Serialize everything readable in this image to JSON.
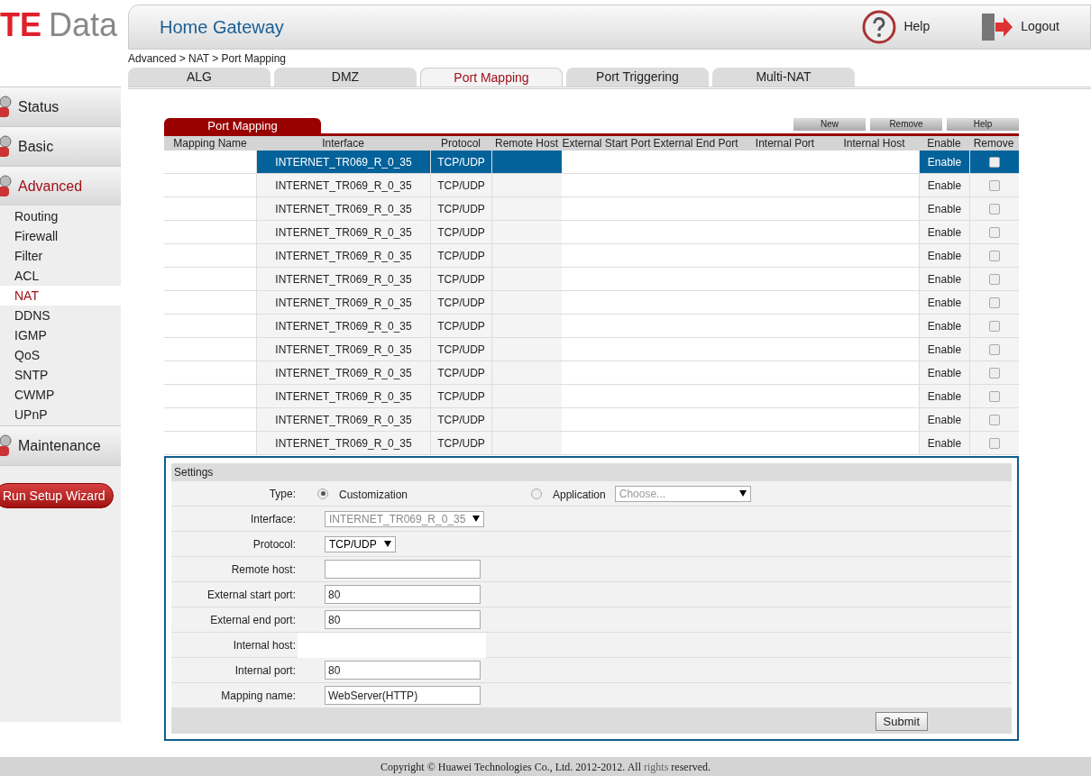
{
  "logo": {
    "accent": "TE",
    "name": "Data"
  },
  "header": {
    "title": "Home Gateway",
    "help": "Help",
    "logout": "Logout"
  },
  "breadcrumb": "Advanced > NAT > Port Mapping",
  "sidebar": {
    "sections": [
      {
        "label": "Status",
        "selected": false
      },
      {
        "label": "Basic",
        "selected": false
      },
      {
        "label": "Advanced",
        "selected": true,
        "children": [
          {
            "label": "Routing",
            "selected": false
          },
          {
            "label": "Firewall",
            "selected": false
          },
          {
            "label": "Filter",
            "selected": false
          },
          {
            "label": "ACL",
            "selected": false
          },
          {
            "label": "NAT",
            "selected": true
          },
          {
            "label": "DDNS",
            "selected": false
          },
          {
            "label": "IGMP",
            "selected": false
          },
          {
            "label": "QoS",
            "selected": false
          },
          {
            "label": "SNTP",
            "selected": false
          },
          {
            "label": "CWMP",
            "selected": false
          },
          {
            "label": "UPnP",
            "selected": false
          }
        ]
      },
      {
        "label": "Maintenance",
        "selected": false
      }
    ],
    "wizard_button": "Run Setup Wizard"
  },
  "tabs": [
    {
      "label": "ALG",
      "selected": false
    },
    {
      "label": "DMZ",
      "selected": false
    },
    {
      "label": "Port Mapping",
      "selected": true
    },
    {
      "label": "Port Triggering",
      "selected": false
    },
    {
      "label": "Multi-NAT",
      "selected": false
    }
  ],
  "table": {
    "title": "Port Mapping",
    "buttons": [
      "New",
      "Remove",
      "Help"
    ],
    "columns": [
      "Mapping Name",
      "Interface",
      "Protocol",
      "Remote Host",
      "External Start Port",
      "External End Port",
      "Internal Port",
      "Internal Host",
      "Enable",
      "Remove"
    ],
    "rows": [
      {
        "interface": "INTERNET_TR069_R_0_35",
        "protocol": "TCP/UDP",
        "enable": "Enable",
        "checked": false,
        "selected": true
      },
      {
        "interface": "INTERNET_TR069_R_0_35",
        "protocol": "TCP/UDP",
        "enable": "Enable",
        "checked": false,
        "selected": false
      },
      {
        "interface": "INTERNET_TR069_R_0_35",
        "protocol": "TCP/UDP",
        "enable": "Enable",
        "checked": false,
        "selected": false
      },
      {
        "interface": "INTERNET_TR069_R_0_35",
        "protocol": "TCP/UDP",
        "enable": "Enable",
        "checked": false,
        "selected": false
      },
      {
        "interface": "INTERNET_TR069_R_0_35",
        "protocol": "TCP/UDP",
        "enable": "Enable",
        "checked": false,
        "selected": false
      },
      {
        "interface": "INTERNET_TR069_R_0_35",
        "protocol": "TCP/UDP",
        "enable": "Enable",
        "checked": false,
        "selected": false
      },
      {
        "interface": "INTERNET_TR069_R_0_35",
        "protocol": "TCP/UDP",
        "enable": "Enable",
        "checked": false,
        "selected": false
      },
      {
        "interface": "INTERNET_TR069_R_0_35",
        "protocol": "TCP/UDP",
        "enable": "Enable",
        "checked": false,
        "selected": false
      },
      {
        "interface": "INTERNET_TR069_R_0_35",
        "protocol": "TCP/UDP",
        "enable": "Enable",
        "checked": false,
        "selected": false
      },
      {
        "interface": "INTERNET_TR069_R_0_35",
        "protocol": "TCP/UDP",
        "enable": "Enable",
        "checked": false,
        "selected": false
      },
      {
        "interface": "INTERNET_TR069_R_0_35",
        "protocol": "TCP/UDP",
        "enable": "Enable",
        "checked": false,
        "selected": false
      },
      {
        "interface": "INTERNET_TR069_R_0_35",
        "protocol": "TCP/UDP",
        "enable": "Enable",
        "checked": false,
        "selected": false
      },
      {
        "interface": "INTERNET_TR069_R_0_35",
        "protocol": "TCP/UDP",
        "enable": "Enable",
        "checked": false,
        "selected": false
      }
    ]
  },
  "settings": {
    "title": "Settings",
    "type": {
      "label": "Type:",
      "options": [
        {
          "label": "Customization",
          "selected": true
        },
        {
          "label": "Application",
          "selected": false
        }
      ],
      "application_select": "Choose..."
    },
    "fields": [
      {
        "kind": "select",
        "label": "Interface:",
        "value": "INTERNET_TR069_R_0_35",
        "disabled": true
      },
      {
        "kind": "select",
        "label": "Protocol:",
        "value": "TCP/UDP",
        "disabled": false
      },
      {
        "kind": "input",
        "label": "Remote host:"
      },
      {
        "kind": "input",
        "label": "External start port:",
        "value": "80"
      },
      {
        "kind": "input",
        "label": "External end port:",
        "value": "80"
      },
      {
        "kind": "hidden",
        "label": "Internal host:"
      },
      {
        "kind": "input",
        "label": "Internal port:",
        "value": "80"
      },
      {
        "kind": "input",
        "label": "Mapping name:",
        "value": "WebServer(HTTP)"
      }
    ],
    "submit": "Submit"
  },
  "footer": {
    "before": "Copyright © Huawei Technologies Co., Ltd. 2012-2012. All ",
    "link": "rights",
    "after": " reserved."
  }
}
